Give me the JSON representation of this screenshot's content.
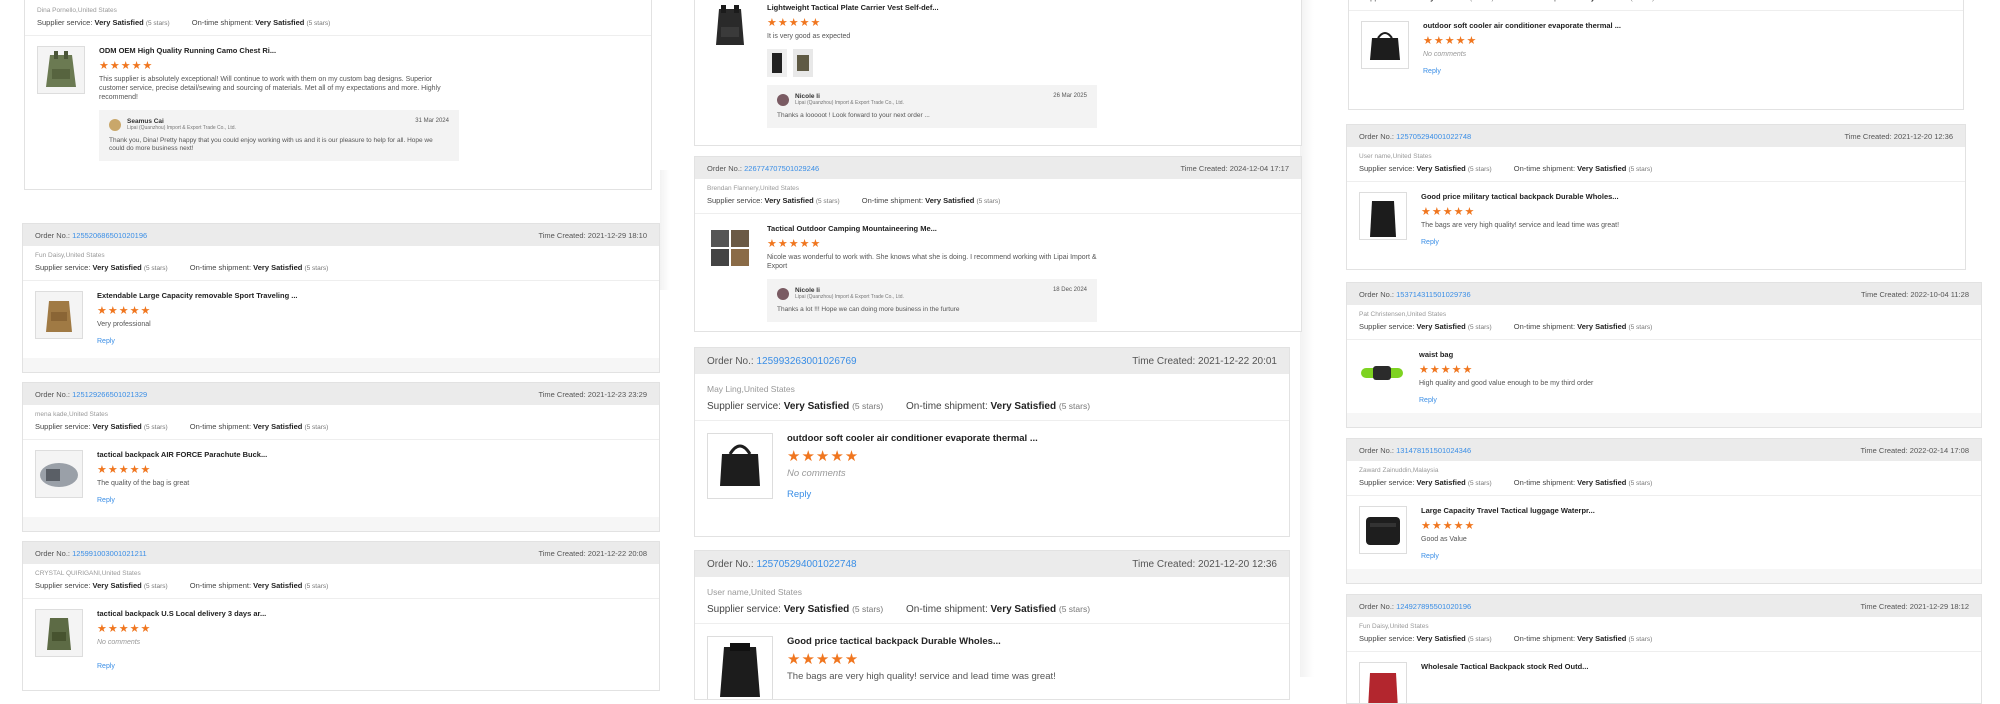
{
  "labels": {
    "order_no": "Order No.:",
    "time_created": "Time Created:",
    "supplier_service": "Supplier service:",
    "ontime_shipment": "On-time shipment:",
    "very_satisfied": "Very Satisfied",
    "five_stars": "(5 stars)",
    "reply": "Reply",
    "no_comments": "No comments"
  },
  "colors": {
    "accent": "#3a8ee6",
    "stars": "#f0761f",
    "header_bg": "#ebebeb"
  },
  "col1": {
    "card0": {
      "buyer": "Dina Pornello,United States",
      "product": "ODM OEM High Quality Running Camo Chest Ri...",
      "stars": "★★★★★",
      "comment": "This supplier is absolutely exceptional! Will continue to work with them on my custom bag designs. Superior customer service, precise detail/sewing and sourcing of materials. Met all of my expectations and more. Highly recommend!",
      "reply_name": "Seamus Cai",
      "reply_company": "Lipai (Quanzhou) Import & Export Trade Co., Ltd.",
      "reply_date": "31 Mar 2024",
      "reply_text": "Thank you, Dina! Pretty happy that you could enjoy working with us and it is our pleasure to help for all. Hope we could do more business next!"
    },
    "card1": {
      "order": "125520686501020196",
      "time": "2021-12-29 18:10",
      "buyer": "Fun Daisy,United States",
      "product": "Extendable Large Capacity removable Sport Traveling ...",
      "stars": "★★★★★",
      "comment": "Very professional"
    },
    "card2": {
      "order": "125129266501021329",
      "time": "2021-12-23 23:29",
      "buyer": "mena kade,United States",
      "product": "tactical backpack AIR FORCE Parachute Buck...",
      "stars": "★★★★★",
      "comment": "The quality of the bag is great"
    },
    "card3": {
      "order": "125991003001021211",
      "time": "2021-12-22 20:08",
      "buyer": "CRYSTAL QUIRIGANI,United States",
      "product": "tactical backpack U.S Local delivery 3 days ar...",
      "stars": "★★★★★"
    }
  },
  "col2": {
    "card0": {
      "product": "Lightweight Tactical Plate Carrier Vest Self-def...",
      "stars": "★★★★★",
      "comment": "It is very good as expected",
      "reply_name": "Nicole li",
      "reply_company": "Lipai (Quanzhou) Import & Export Trade Co., Ltd.",
      "reply_date": "26 Mar 2025",
      "reply_text": "Thanks a looooot ! Look forward to your next order ..."
    },
    "card1": {
      "order": "226774707501029246",
      "time": "2024-12-04 17:17",
      "buyer": "Brendan Flannery,United States",
      "product": "Tactical Outdoor Camping Mountaineering Me...",
      "stars": "★★★★★",
      "comment": "Nicole was wonderful to work with. She knows what she is doing. I recommend working with Lipai Import & Export",
      "reply_name": "Nicole li",
      "reply_company": "Lipai (Quanzhou) Import & Export Trade Co., Ltd.",
      "reply_date": "18 Dec 2024",
      "reply_text": "Thanks a lot !!!    Hope we can doing more business in the furture"
    },
    "card2": {
      "order": "125993263001026769",
      "time": "2021-12-22 20:01",
      "buyer": "May Ling,United States",
      "product": "outdoor soft cooler air conditioner evaporate thermal ...",
      "stars": "★★★★★"
    },
    "card3": {
      "order": "125705294001022748",
      "time": "2021-12-20 12:36",
      "buyer": "User name,United States",
      "product": "Good price tactical backpack Durable Wholes...",
      "stars": "★★★★★",
      "comment": "The bags are very high quality! service and lead time was great!"
    }
  },
  "col3": {
    "card0": {
      "product": "outdoor soft cooler air conditioner evaporate thermal ...",
      "stars": "★★★★★"
    },
    "card1": {
      "order": "125705294001022748",
      "time": "2021-12-20 12:36",
      "buyer": "User name,United States",
      "product": "Good price military tactical backpack Durable Wholes...",
      "stars": "★★★★★",
      "comment": "The bags are very high quality! service and lead time was great!"
    },
    "card2": {
      "order": "153714311501029736",
      "time": "2022-10-04 11:28",
      "buyer": "Pat Christensen,United States",
      "product": "waist bag",
      "stars": "★★★★★",
      "comment": "High quality and good value enough to be my third order"
    },
    "card3": {
      "order": "131478151501024346",
      "time": "2022-02-14 17:08",
      "buyer": "Zaward Zainuddin,Malaysia",
      "product": "Large Capacity Travel Tactical luggage Waterpr...",
      "stars": "★★★★★",
      "comment": "Good as Value"
    },
    "card4": {
      "order": "124927895501020196",
      "time": "2021-12-29 18:12",
      "buyer": "Fun Daisy,United States",
      "product": "Wholesale Tactical Backpack stock Red Outd..."
    }
  }
}
